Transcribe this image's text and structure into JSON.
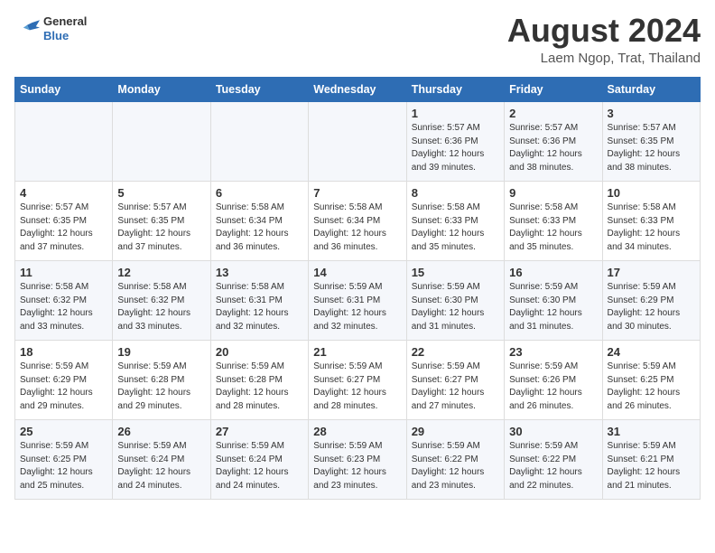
{
  "header": {
    "logo_general": "General",
    "logo_blue": "Blue",
    "main_title": "August 2024",
    "sub_title": "Laem Ngop, Trat, Thailand"
  },
  "weekdays": [
    "Sunday",
    "Monday",
    "Tuesday",
    "Wednesday",
    "Thursday",
    "Friday",
    "Saturday"
  ],
  "weeks": [
    [
      {
        "num": "",
        "info": ""
      },
      {
        "num": "",
        "info": ""
      },
      {
        "num": "",
        "info": ""
      },
      {
        "num": "",
        "info": ""
      },
      {
        "num": "1",
        "info": "Sunrise: 5:57 AM\nSunset: 6:36 PM\nDaylight: 12 hours\nand 39 minutes."
      },
      {
        "num": "2",
        "info": "Sunrise: 5:57 AM\nSunset: 6:36 PM\nDaylight: 12 hours\nand 38 minutes."
      },
      {
        "num": "3",
        "info": "Sunrise: 5:57 AM\nSunset: 6:35 PM\nDaylight: 12 hours\nand 38 minutes."
      }
    ],
    [
      {
        "num": "4",
        "info": "Sunrise: 5:57 AM\nSunset: 6:35 PM\nDaylight: 12 hours\nand 37 minutes."
      },
      {
        "num": "5",
        "info": "Sunrise: 5:57 AM\nSunset: 6:35 PM\nDaylight: 12 hours\nand 37 minutes."
      },
      {
        "num": "6",
        "info": "Sunrise: 5:58 AM\nSunset: 6:34 PM\nDaylight: 12 hours\nand 36 minutes."
      },
      {
        "num": "7",
        "info": "Sunrise: 5:58 AM\nSunset: 6:34 PM\nDaylight: 12 hours\nand 36 minutes."
      },
      {
        "num": "8",
        "info": "Sunrise: 5:58 AM\nSunset: 6:33 PM\nDaylight: 12 hours\nand 35 minutes."
      },
      {
        "num": "9",
        "info": "Sunrise: 5:58 AM\nSunset: 6:33 PM\nDaylight: 12 hours\nand 35 minutes."
      },
      {
        "num": "10",
        "info": "Sunrise: 5:58 AM\nSunset: 6:33 PM\nDaylight: 12 hours\nand 34 minutes."
      }
    ],
    [
      {
        "num": "11",
        "info": "Sunrise: 5:58 AM\nSunset: 6:32 PM\nDaylight: 12 hours\nand 33 minutes."
      },
      {
        "num": "12",
        "info": "Sunrise: 5:58 AM\nSunset: 6:32 PM\nDaylight: 12 hours\nand 33 minutes."
      },
      {
        "num": "13",
        "info": "Sunrise: 5:58 AM\nSunset: 6:31 PM\nDaylight: 12 hours\nand 32 minutes."
      },
      {
        "num": "14",
        "info": "Sunrise: 5:59 AM\nSunset: 6:31 PM\nDaylight: 12 hours\nand 32 minutes."
      },
      {
        "num": "15",
        "info": "Sunrise: 5:59 AM\nSunset: 6:30 PM\nDaylight: 12 hours\nand 31 minutes."
      },
      {
        "num": "16",
        "info": "Sunrise: 5:59 AM\nSunset: 6:30 PM\nDaylight: 12 hours\nand 31 minutes."
      },
      {
        "num": "17",
        "info": "Sunrise: 5:59 AM\nSunset: 6:29 PM\nDaylight: 12 hours\nand 30 minutes."
      }
    ],
    [
      {
        "num": "18",
        "info": "Sunrise: 5:59 AM\nSunset: 6:29 PM\nDaylight: 12 hours\nand 29 minutes."
      },
      {
        "num": "19",
        "info": "Sunrise: 5:59 AM\nSunset: 6:28 PM\nDaylight: 12 hours\nand 29 minutes."
      },
      {
        "num": "20",
        "info": "Sunrise: 5:59 AM\nSunset: 6:28 PM\nDaylight: 12 hours\nand 28 minutes."
      },
      {
        "num": "21",
        "info": "Sunrise: 5:59 AM\nSunset: 6:27 PM\nDaylight: 12 hours\nand 28 minutes."
      },
      {
        "num": "22",
        "info": "Sunrise: 5:59 AM\nSunset: 6:27 PM\nDaylight: 12 hours\nand 27 minutes."
      },
      {
        "num": "23",
        "info": "Sunrise: 5:59 AM\nSunset: 6:26 PM\nDaylight: 12 hours\nand 26 minutes."
      },
      {
        "num": "24",
        "info": "Sunrise: 5:59 AM\nSunset: 6:25 PM\nDaylight: 12 hours\nand 26 minutes."
      }
    ],
    [
      {
        "num": "25",
        "info": "Sunrise: 5:59 AM\nSunset: 6:25 PM\nDaylight: 12 hours\nand 25 minutes."
      },
      {
        "num": "26",
        "info": "Sunrise: 5:59 AM\nSunset: 6:24 PM\nDaylight: 12 hours\nand 24 minutes."
      },
      {
        "num": "27",
        "info": "Sunrise: 5:59 AM\nSunset: 6:24 PM\nDaylight: 12 hours\nand 24 minutes."
      },
      {
        "num": "28",
        "info": "Sunrise: 5:59 AM\nSunset: 6:23 PM\nDaylight: 12 hours\nand 23 minutes."
      },
      {
        "num": "29",
        "info": "Sunrise: 5:59 AM\nSunset: 6:22 PM\nDaylight: 12 hours\nand 23 minutes."
      },
      {
        "num": "30",
        "info": "Sunrise: 5:59 AM\nSunset: 6:22 PM\nDaylight: 12 hours\nand 22 minutes."
      },
      {
        "num": "31",
        "info": "Sunrise: 5:59 AM\nSunset: 6:21 PM\nDaylight: 12 hours\nand 21 minutes."
      }
    ]
  ]
}
